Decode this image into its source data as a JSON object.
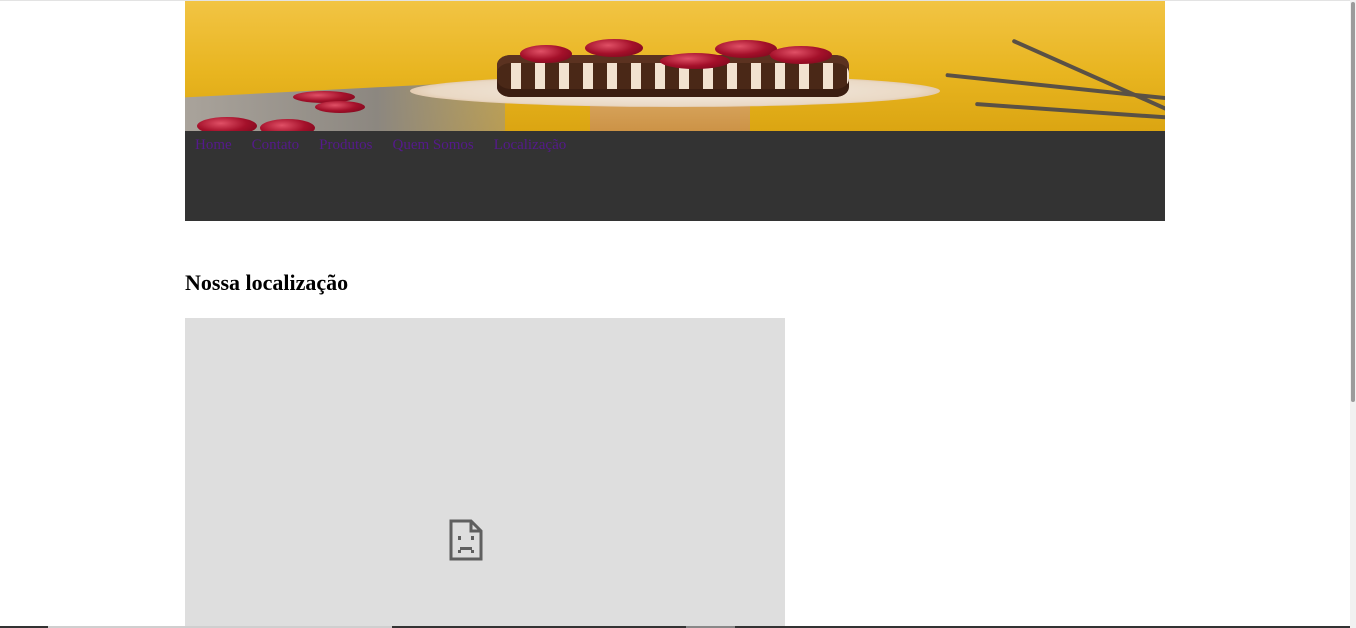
{
  "nav": {
    "items": [
      {
        "label": "Home"
      },
      {
        "label": "Contato"
      },
      {
        "label": "Produtos"
      },
      {
        "label": "Quem Somos"
      },
      {
        "label": "Localização"
      }
    ]
  },
  "main": {
    "section_title": "Nossa localização"
  },
  "colors": {
    "navbar_bg": "#333333",
    "link": "#551a8b",
    "map_placeholder_bg": "#dedede"
  },
  "icons": {
    "banner": "cherry-cake-banner-image",
    "map_error": "broken-page-icon"
  }
}
